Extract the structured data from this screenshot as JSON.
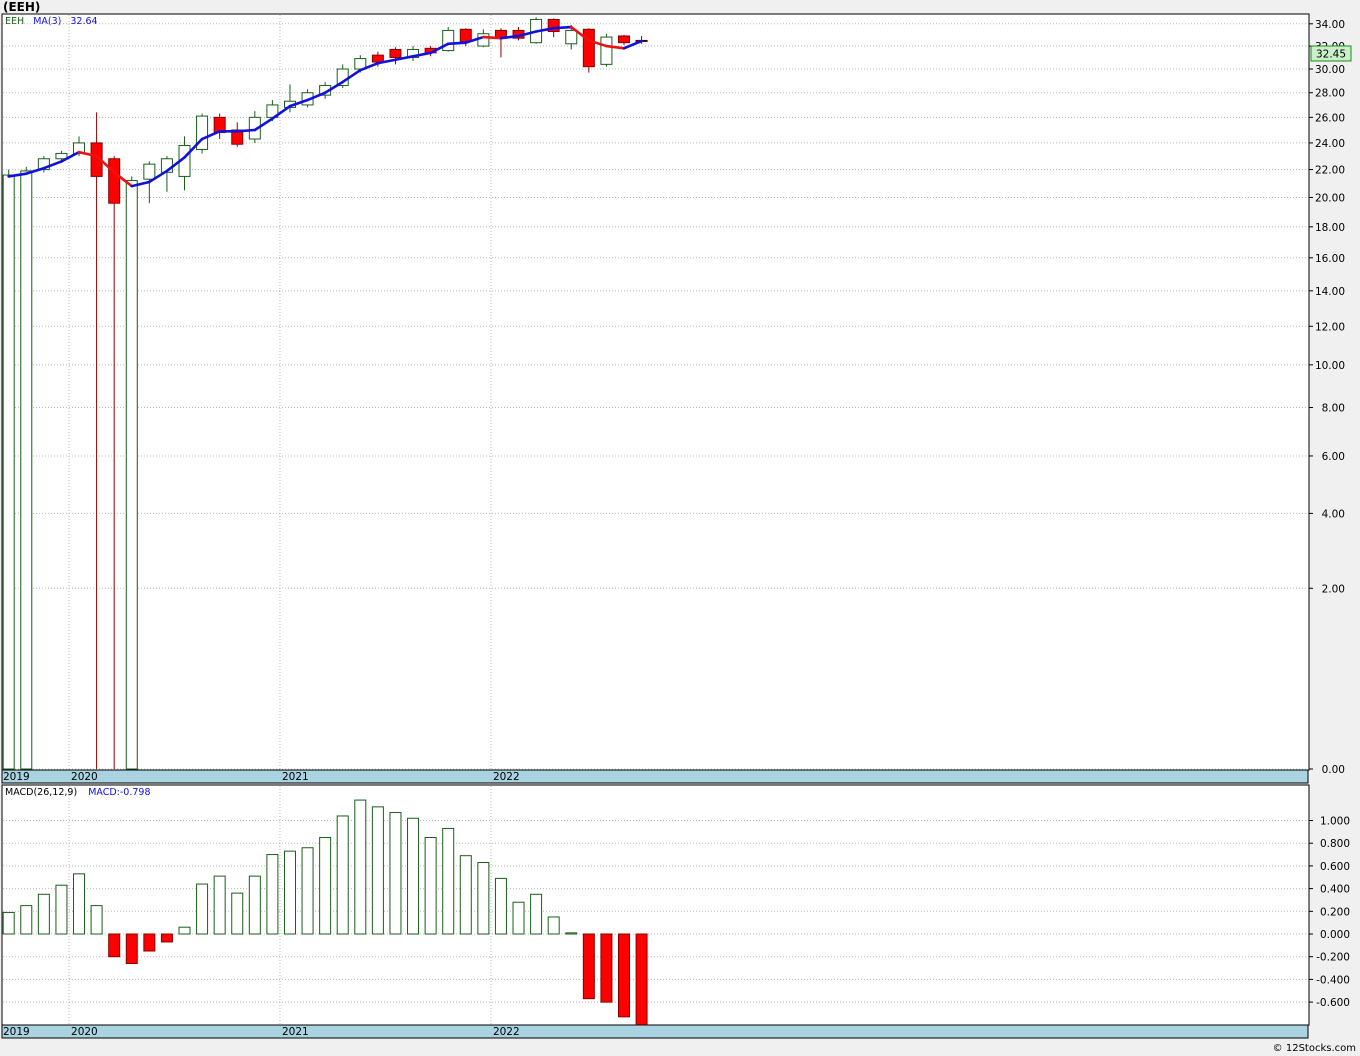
{
  "title": "(EEH)",
  "credit": "© 12Stocks.com",
  "colors": {
    "up": "#1a5e1a",
    "down": "#ff0000",
    "ma_up": "#1111dd",
    "ma_down": "#ee1111",
    "axis_bar": "#a9d3e0",
    "grid": "#b8b8b8",
    "price_box": "#c9f0c9"
  },
  "price_panel": {
    "legend": {
      "symbol": "EEH",
      "ma_label": "MA(3)",
      "ma_value": "32.64"
    },
    "last_price": "32.45",
    "y_ticks": [
      "34.00",
      "32.00",
      "30.00",
      "28.00",
      "26.00",
      "24.00",
      "22.00",
      "20.00",
      "18.00",
      "16.00",
      "14.00",
      "12.00",
      "10.00",
      "8.00",
      "6.00",
      "4.00",
      "2.00",
      "0.00"
    ],
    "years": [
      "2019",
      "2020",
      "2021",
      "2022"
    ]
  },
  "macd_panel": {
    "legend": {
      "label": "MACD(26,12,9)",
      "value_label": "MACD:-0.798"
    },
    "y_ticks": [
      "1.000",
      "0.800",
      "0.600",
      "0.400",
      "0.200",
      "0.000",
      "-0.200",
      "-0.400",
      "-0.600"
    ],
    "years": [
      "2019",
      "2020",
      "2021",
      "2022"
    ]
  },
  "chart_data": [
    {
      "type": "candlestick",
      "interval": "monthly",
      "y_scale": "square-root",
      "ylim": [
        0,
        35
      ],
      "series": [
        {
          "o": 0.0,
          "h": 22.0,
          "l": 0.0,
          "c": 21.6
        },
        {
          "o": 0.0,
          "h": 22.2,
          "l": 0.0,
          "c": 21.9
        },
        {
          "o": 22.0,
          "h": 23.0,
          "l": 21.8,
          "c": 22.8
        },
        {
          "o": 22.8,
          "h": 23.4,
          "l": 22.5,
          "c": 23.2
        },
        {
          "o": 23.2,
          "h": 24.5,
          "l": 23.0,
          "c": 24.0
        },
        {
          "o": 24.0,
          "h": 26.4,
          "l": 0.0,
          "c": 21.5
        },
        {
          "o": 22.8,
          "h": 23.0,
          "l": 0.0,
          "c": 19.6
        },
        {
          "o": 0.0,
          "h": 21.5,
          "l": 0.0,
          "c": 21.2
        },
        {
          "o": 21.3,
          "h": 22.6,
          "l": 19.6,
          "c": 22.4
        },
        {
          "o": 21.8,
          "h": 23.0,
          "l": 20.4,
          "c": 22.8
        },
        {
          "o": 21.5,
          "h": 24.5,
          "l": 20.5,
          "c": 23.8
        },
        {
          "o": 23.5,
          "h": 26.3,
          "l": 23.2,
          "c": 26.1
        },
        {
          "o": 26.0,
          "h": 26.3,
          "l": 24.3,
          "c": 24.8
        },
        {
          "o": 25.0,
          "h": 25.6,
          "l": 23.7,
          "c": 23.9
        },
        {
          "o": 24.3,
          "h": 26.5,
          "l": 24.0,
          "c": 26.0
        },
        {
          "o": 26.0,
          "h": 27.4,
          "l": 25.7,
          "c": 27.0
        },
        {
          "o": 26.8,
          "h": 28.7,
          "l": 26.4,
          "c": 27.3
        },
        {
          "o": 27.0,
          "h": 28.3,
          "l": 26.8,
          "c": 28.0
        },
        {
          "o": 27.8,
          "h": 28.9,
          "l": 27.5,
          "c": 28.6
        },
        {
          "o": 28.6,
          "h": 30.4,
          "l": 28.4,
          "c": 30.0
        },
        {
          "o": 30.0,
          "h": 31.2,
          "l": 29.7,
          "c": 30.9
        },
        {
          "o": 31.2,
          "h": 31.5,
          "l": 30.2,
          "c": 30.6
        },
        {
          "o": 31.7,
          "h": 31.9,
          "l": 30.4,
          "c": 31.0
        },
        {
          "o": 31.0,
          "h": 32.0,
          "l": 30.7,
          "c": 31.7
        },
        {
          "o": 31.8,
          "h": 32.0,
          "l": 31.1,
          "c": 31.4
        },
        {
          "o": 31.6,
          "h": 33.7,
          "l": 31.5,
          "c": 33.4
        },
        {
          "o": 33.5,
          "h": 33.6,
          "l": 32.0,
          "c": 32.4
        },
        {
          "o": 32.0,
          "h": 33.5,
          "l": 31.9,
          "c": 33.1
        },
        {
          "o": 33.4,
          "h": 33.6,
          "l": 31.0,
          "c": 32.7
        },
        {
          "o": 33.4,
          "h": 33.7,
          "l": 32.5,
          "c": 32.7
        },
        {
          "o": 32.3,
          "h": 34.6,
          "l": 32.2,
          "c": 34.4
        },
        {
          "o": 34.4,
          "h": 34.5,
          "l": 32.8,
          "c": 33.3
        },
        {
          "o": 32.2,
          "h": 33.9,
          "l": 31.7,
          "c": 33.4
        },
        {
          "o": 33.5,
          "h": 33.6,
          "l": 29.7,
          "c": 30.2
        },
        {
          "o": 30.4,
          "h": 33.1,
          "l": 30.2,
          "c": 32.8
        },
        {
          "o": 32.9,
          "h": 33.0,
          "l": 32.1,
          "c": 32.3
        },
        {
          "o": 32.5,
          "h": 32.9,
          "l": 32.2,
          "c": 32.45
        }
      ],
      "ma3": [
        21.5,
        21.7,
        22.1,
        22.6,
        23.3,
        23.0,
        21.8,
        20.8,
        21.1,
        21.9,
        22.9,
        24.3,
        24.9,
        24.9,
        25.0,
        25.9,
        26.9,
        27.4,
        28.0,
        28.9,
        29.9,
        30.5,
        30.8,
        31.1,
        31.4,
        32.2,
        32.3,
        32.8,
        32.7,
        32.9,
        33.3,
        33.6,
        33.7,
        32.5,
        32.0,
        31.8,
        32.45
      ],
      "years": [
        "2019",
        "2020",
        "2021",
        "2022"
      ]
    },
    {
      "type": "bar",
      "name": "MACD(26,12,9)",
      "ylim": [
        -0.8,
        1.2
      ],
      "values": [
        0.19,
        0.25,
        0.35,
        0.43,
        0.53,
        0.25,
        -0.2,
        -0.26,
        -0.15,
        -0.07,
        0.06,
        0.44,
        0.51,
        0.36,
        0.51,
        0.7,
        0.73,
        0.76,
        0.85,
        1.04,
        1.18,
        1.12,
        1.07,
        1.02,
        0.85,
        0.93,
        0.69,
        0.63,
        0.49,
        0.28,
        0.35,
        0.15,
        0.01,
        -0.57,
        -0.6,
        -0.73,
        -0.798
      ]
    }
  ]
}
